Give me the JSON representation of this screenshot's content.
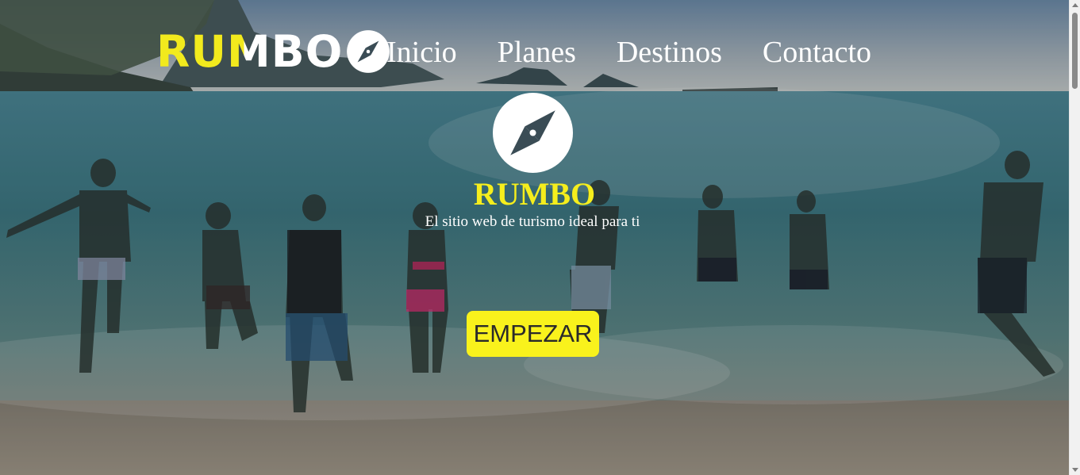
{
  "brand": {
    "logo_text": "RUMBO",
    "logo_icon": "compass-icon"
  },
  "nav": {
    "items": [
      {
        "label": "Inicio"
      },
      {
        "label": "Planes"
      },
      {
        "label": "Destinos"
      },
      {
        "label": "Contacto"
      }
    ]
  },
  "hero": {
    "icon": "compass-icon",
    "title": "RUMBO",
    "tagline": "El sitio web de turismo ideal para ti",
    "cta_label": "EMPEZAR",
    "background": "beach-photo-people-running-into-sea"
  },
  "colors": {
    "accent_yellow": "#f5ee1d",
    "button_yellow": "#f9f21c",
    "text_white": "#ffffff"
  }
}
